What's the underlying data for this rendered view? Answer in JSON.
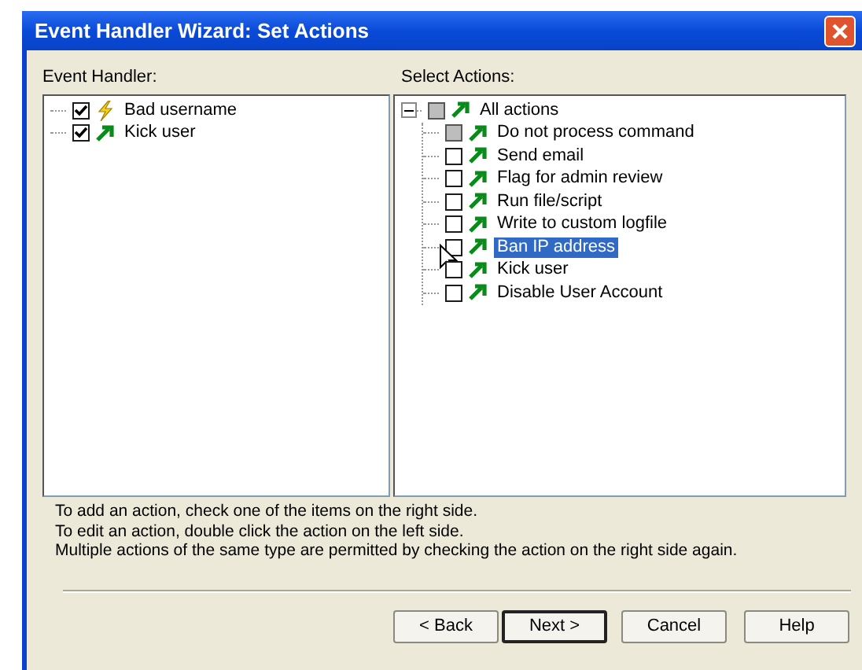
{
  "window": {
    "title": "Event Handler Wizard: Set Actions"
  },
  "event_handler": {
    "label": "Event Handler:",
    "items": [
      {
        "text": "Bad username",
        "kind": "event",
        "checked": true,
        "selected": false
      },
      {
        "text": "Kick user",
        "kind": "action",
        "checked": true,
        "selected": false
      }
    ]
  },
  "select_actions": {
    "label": "Select Actions:",
    "root": {
      "text": "All actions",
      "kind": "action",
      "checked": false,
      "partial": true,
      "expanded": true,
      "children": [
        {
          "text": "Do not process command",
          "kind": "action",
          "checked": false,
          "partial": true,
          "selected": false
        },
        {
          "text": "Send email",
          "kind": "action",
          "checked": false,
          "partial": false,
          "selected": false
        },
        {
          "text": "Flag for admin review",
          "kind": "action",
          "checked": false,
          "partial": false,
          "selected": false
        },
        {
          "text": "Run file/script",
          "kind": "action",
          "checked": false,
          "partial": false,
          "selected": false
        },
        {
          "text": "Write to custom logfile",
          "kind": "action",
          "checked": false,
          "partial": false,
          "selected": false
        },
        {
          "text": "Ban IP address",
          "kind": "action",
          "checked": false,
          "partial": false,
          "selected": true
        },
        {
          "text": "Kick user",
          "kind": "action",
          "checked": false,
          "partial": false,
          "selected": false
        },
        {
          "text": "Disable User Account",
          "kind": "action",
          "checked": false,
          "partial": false,
          "selected": false
        }
      ]
    }
  },
  "notes": [
    "To add an action, check one of the items on the right side.",
    "To edit an action, double click the action on the left side.",
    "Multiple actions of the same type are permitted by checking the action on the right side again."
  ],
  "buttons": [
    {
      "label": "< Back",
      "default": false
    },
    {
      "label": "Next >",
      "default": true
    },
    {
      "label": "Cancel",
      "default": false
    },
    {
      "label": "Help",
      "default": false
    }
  ]
}
